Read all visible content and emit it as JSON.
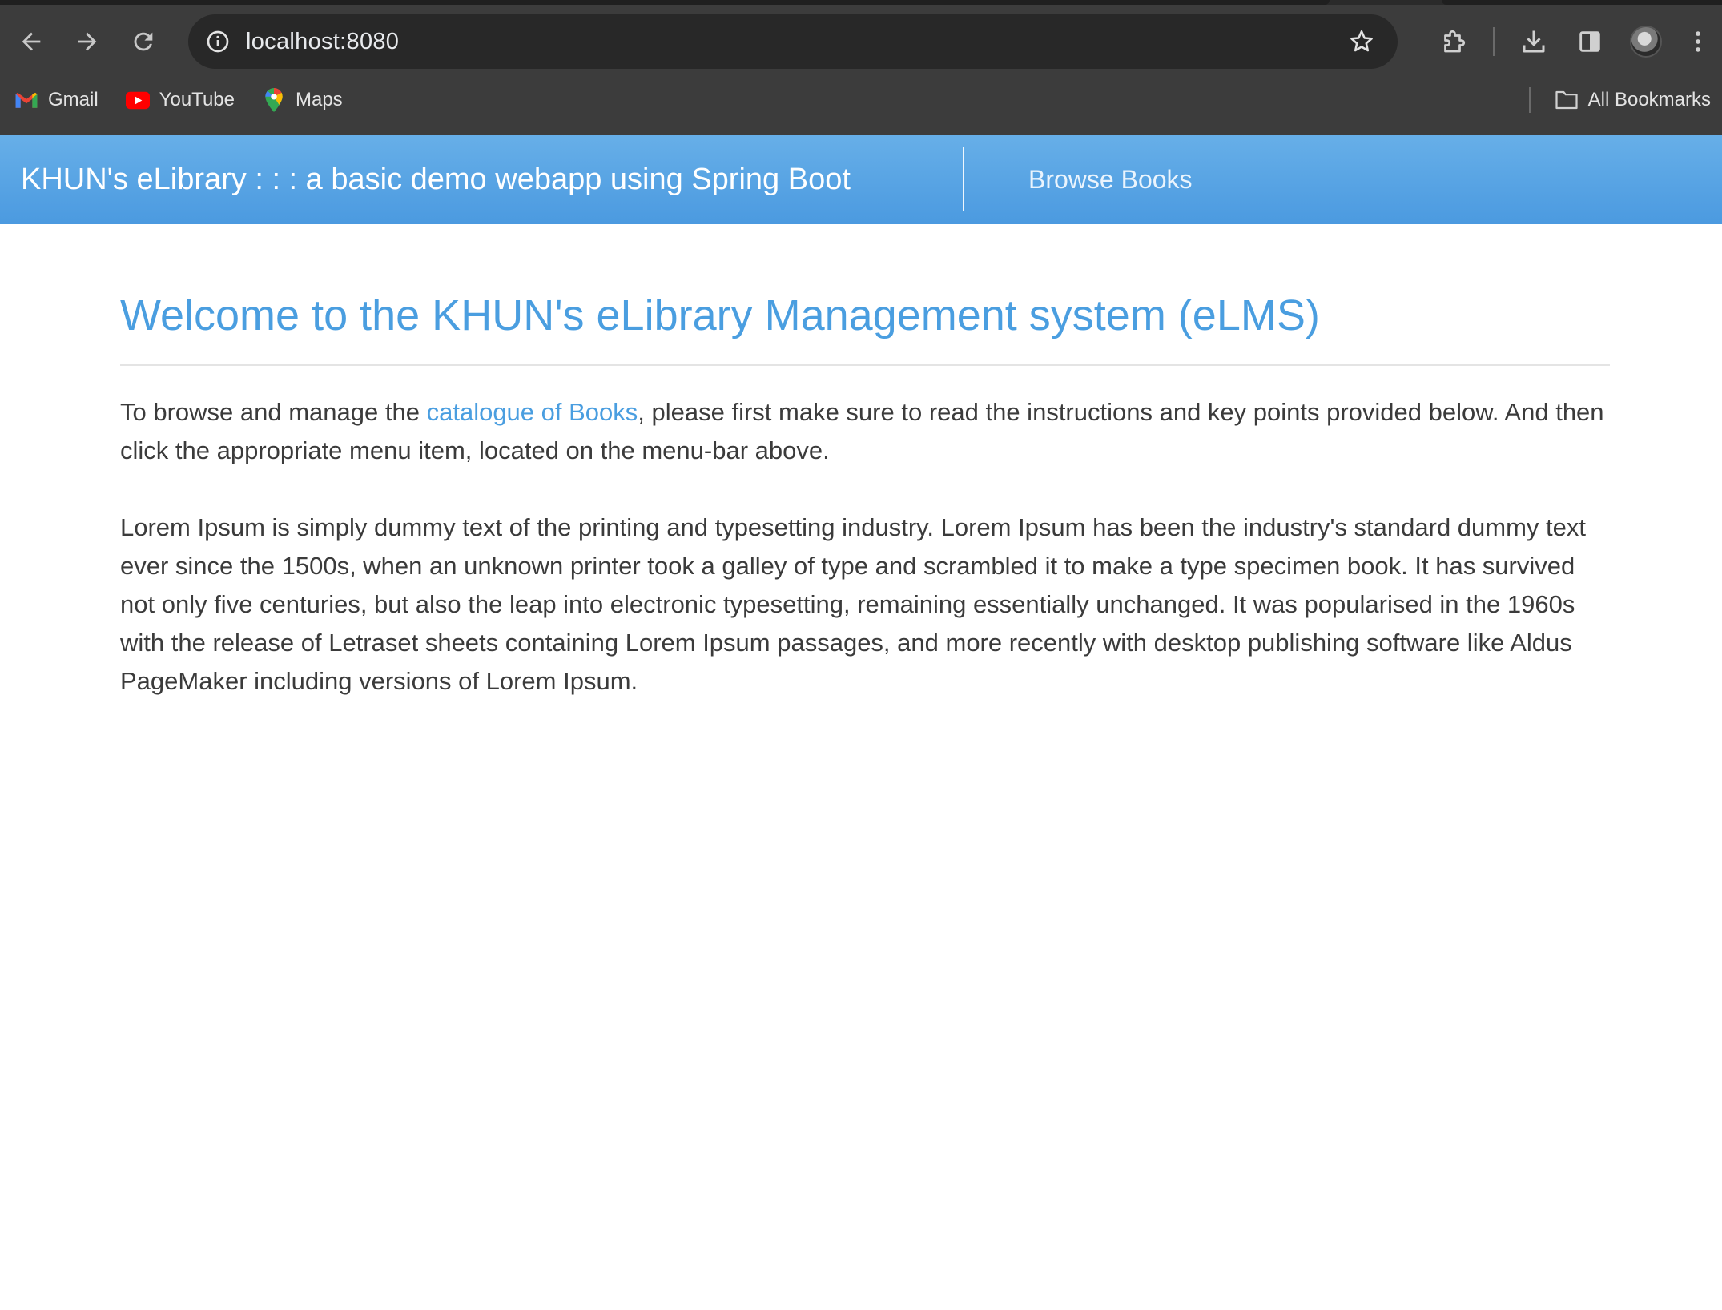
{
  "browser": {
    "url": "localhost:8080",
    "bookmarks": [
      {
        "label": "Gmail",
        "icon": "gmail-icon"
      },
      {
        "label": "YouTube",
        "icon": "youtube-icon"
      },
      {
        "label": "Maps",
        "icon": "maps-icon"
      }
    ],
    "all_bookmarks_label": "All Bookmarks"
  },
  "header": {
    "brand": "KHUN's eLibrary : : : a basic demo webapp using Spring Boot",
    "nav_link": "Browse Books",
    "bg_top": "#67afe8",
    "bg_bottom": "#4b9ae0"
  },
  "main": {
    "title": "Welcome to the KHUN's eLibrary Management system (eLMS)",
    "intro_before_link": "To browse and manage the ",
    "intro_link": "catalogue of Books",
    "intro_after_link": ", please first make sure to read the instructions and key points provided below. And then click the appropriate menu item, located on the menu-bar above.",
    "body": "Lorem Ipsum is simply dummy text of the printing and typesetting industry. Lorem Ipsum has been the industry's standard dummy text ever since the 1500s, when an unknown printer took a galley of type and scrambled it to make a type specimen book. It has survived not only five centuries, but also the leap into electronic typesetting, remaining essentially unchanged. It was popularised in the 1960s with the release of Letraset sheets containing Lorem Ipsum passages, and more recently with desktop publishing software like Aldus PageMaker including versions of Lorem Ipsum.",
    "accent_color": "#4a9ee0"
  }
}
